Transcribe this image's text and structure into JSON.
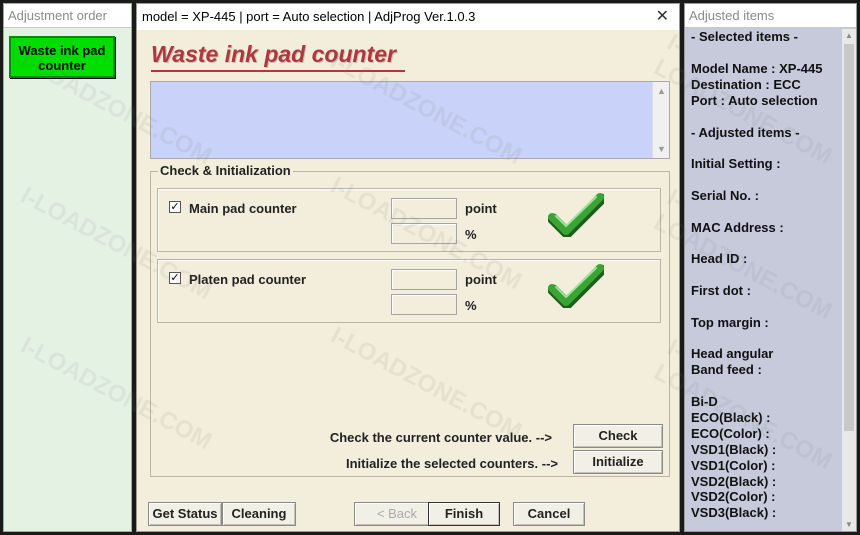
{
  "left_pane": {
    "title": "Adjustment order",
    "active_item": "Waste ink pad counter"
  },
  "window": {
    "title": "model = XP-445 | port = Auto selection | AdjProg Ver.1.0.3",
    "close_glyph": "✕",
    "heading": "Waste ink pad counter",
    "group_label": "Check & Initialization",
    "main_pad": {
      "label": "Main pad counter",
      "checked": true,
      "point_value": "",
      "percent_value": "",
      "point_unit": "point",
      "percent_unit": "%"
    },
    "platen_pad": {
      "label": "Platen pad counter",
      "checked": true,
      "point_value": "",
      "percent_value": "",
      "point_unit": "point",
      "percent_unit": "%"
    },
    "check_hint": "Check the current counter value. -->",
    "init_hint": "Initialize the selected counters. -->",
    "buttons": {
      "check": "Check",
      "initialize": "Initialize",
      "get_status": "Get Status",
      "cleaning": "Cleaning",
      "back": "< Back",
      "finish": "Finish",
      "cancel": "Cancel"
    }
  },
  "right_pane": {
    "title": "Adjusted items",
    "selected_header": "- Selected items -",
    "model_name": "Model Name : XP-445",
    "destination": "Destination : ECC",
    "port": "Port : Auto selection",
    "adjusted_header": "- Adjusted items -",
    "initial_setting": "Initial Setting :",
    "serial_no": "Serial No. :",
    "mac_address": "MAC Address :",
    "head_id": "Head ID :",
    "first_dot": "First dot :",
    "top_margin": "Top margin :",
    "head_angular": "Head angular",
    "band_feed": " Band feed :",
    "bi_d": "Bi-D",
    "eco_black": " ECO(Black)  :",
    "eco_color": " ECO(Color)  :",
    "vsd1_black": " VSD1(Black) :",
    "vsd1_color": " VSD1(Color) :",
    "vsd2_black": " VSD2(Black) :",
    "vsd2_color": " VSD2(Color) :",
    "vsd3_black": " VSD3(Black) :"
  },
  "watermark": "I-LOADZONE.COM",
  "colors": {
    "accent_green": "#00dd00",
    "title_red": "#b0373e",
    "textbox_blue": "#c9d2f8",
    "check_green": "#3aa535"
  },
  "icons": {
    "check": "checkmark-icon",
    "close": "close-icon"
  }
}
